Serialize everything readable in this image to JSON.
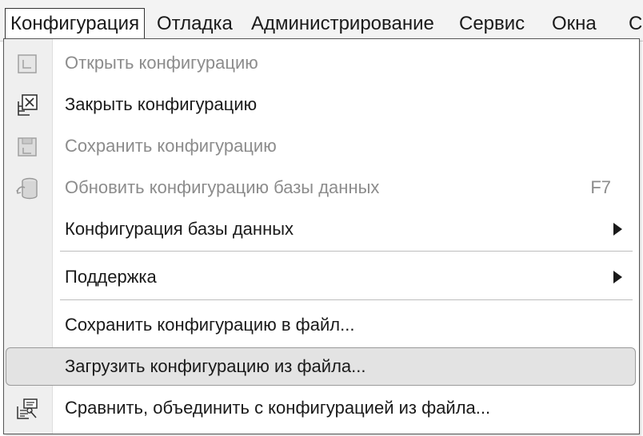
{
  "menubar": {
    "items": [
      {
        "label": "Конфигурация",
        "active": true
      },
      {
        "label": "Отладка"
      },
      {
        "label": "Администрирование"
      },
      {
        "label": "Сервис"
      },
      {
        "label": "Окна"
      },
      {
        "label": "С"
      }
    ]
  },
  "menu": {
    "items": [
      {
        "label": "Открыть конфигурацию",
        "enabled": false,
        "icon": "open-config-icon"
      },
      {
        "label": "Закрыть конфигурацию",
        "enabled": true,
        "icon": "close-config-icon"
      },
      {
        "label": "Сохранить конфигурацию",
        "enabled": false,
        "icon": "save-config-icon"
      },
      {
        "label": "Обновить конфигурацию базы данных",
        "enabled": false,
        "shortcut": "F7",
        "icon": "database-update-icon"
      },
      {
        "label": "Конфигурация базы данных",
        "enabled": true,
        "submenu": true
      },
      {
        "label": "Поддержка",
        "enabled": true,
        "submenu": true
      },
      {
        "label": "Сохранить конфигурацию в файл...",
        "enabled": true
      },
      {
        "label": "Загрузить конфигурацию из файла...",
        "enabled": true,
        "highlighted": true
      },
      {
        "label": "Сравнить, объединить с конфигурацией из файла...",
        "enabled": true,
        "icon": "compare-merge-icon"
      }
    ]
  }
}
